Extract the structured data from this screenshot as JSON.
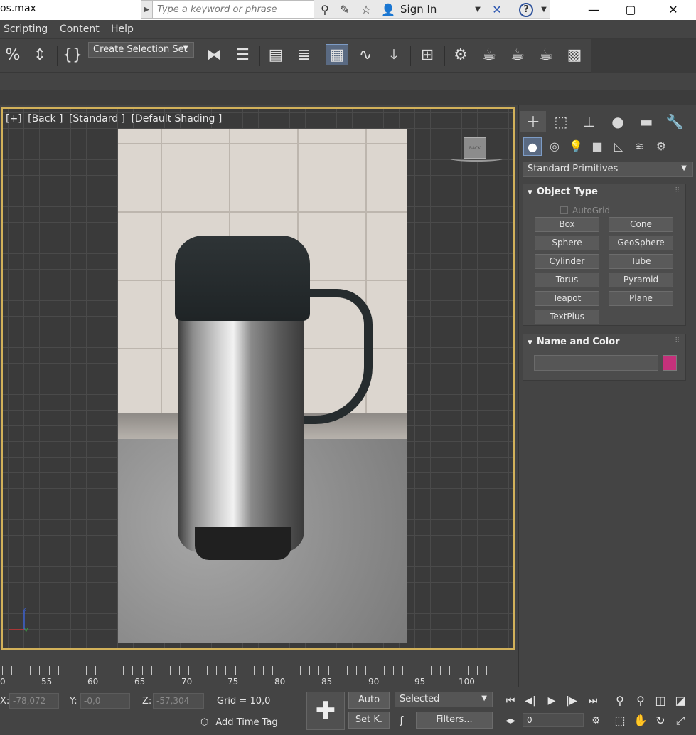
{
  "titlebar": {
    "filename": "os.max",
    "search_placeholder": "Type a keyword or phrase",
    "signin_label": "Sign In",
    "minimize": "—",
    "maximize": "▢",
    "close": "✕"
  },
  "menu": [
    "Scripting",
    "Content",
    "Help"
  ],
  "toolbar": {
    "selection_set_label": "Create Selection Set"
  },
  "viewport": {
    "labels": [
      "[+]",
      "[Back ]",
      "[Standard ]",
      "[Default Shading ]"
    ],
    "viewcube_label": "BACK"
  },
  "command_panel": {
    "category_dropdown": "Standard Primitives",
    "object_type": {
      "title": "Object Type",
      "autogrid_label": "AutoGrid",
      "buttons": [
        "Box",
        "Cone",
        "Sphere",
        "GeoSphere",
        "Cylinder",
        "Tube",
        "Torus",
        "Pyramid",
        "Teapot",
        "Plane",
        "TextPlus"
      ]
    },
    "name_and_color": {
      "title": "Name and Color",
      "name_value": "",
      "swatch_color": "#c5317b"
    }
  },
  "timeline": {
    "labels": [
      "0",
      "55",
      "60",
      "65",
      "70",
      "75",
      "80",
      "85",
      "90",
      "95",
      "100"
    ]
  },
  "status": {
    "x_label": "X:",
    "x_value": "-78,072",
    "y_label": "Y:",
    "y_value": "-0,0",
    "z_label": "Z:",
    "z_value": "-57,304",
    "grid_label": "Grid = 10,0",
    "add_time_tag": "Add Time Tag",
    "auto_label": "Auto",
    "setk_label": "Set K.",
    "selected_dropdown": "Selected",
    "filters_label": "Filters...",
    "frame_value": "0"
  },
  "colors": {
    "viewport_border": "#d2b15a",
    "active_button": "#5a6a82",
    "swatch": "#c5317b"
  }
}
